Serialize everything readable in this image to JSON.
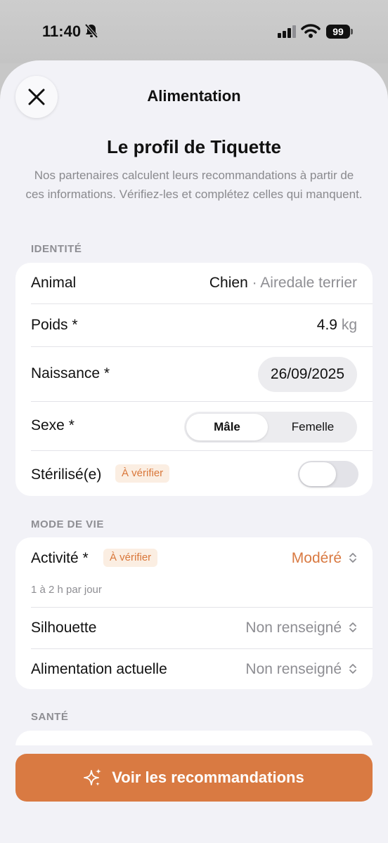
{
  "status_bar": {
    "time": "11:40",
    "battery": "99",
    "icons": [
      "bell-slash-icon",
      "signal-icon",
      "wifi-icon",
      "battery-icon"
    ]
  },
  "nav": {
    "title": "Alimentation",
    "close_icon": "close-icon"
  },
  "header": {
    "title": "Le profil de Tiquette",
    "subtitle": "Nos partenaires calculent leurs recommandations à partir de ces informations. Vérifiez-les et complétez celles qui manquent."
  },
  "identite": {
    "section_label": "IDENTITÉ",
    "animal": {
      "label": "Animal",
      "species": "Chien",
      "separator": " · ",
      "breed": "Airedale terrier"
    },
    "poids": {
      "label": "Poids *",
      "value": "4.9",
      "unit": "kg"
    },
    "naissance": {
      "label": "Naissance *",
      "value": "26/09/2025"
    },
    "sexe": {
      "label": "Sexe *",
      "options": [
        "Mâle",
        "Femelle"
      ],
      "selected": "Mâle"
    },
    "sterilise": {
      "label": "Stérilisé(e)",
      "badge": "À vérifier",
      "toggle_on": false
    }
  },
  "mode_de_vie": {
    "section_label": "MODE DE VIE",
    "activite": {
      "label": "Activité *",
      "badge": "À vérifier",
      "value": "Modéré",
      "helper": "1 à 2 h par jour"
    },
    "silhouette": {
      "label": "Silhouette",
      "value": "Non renseigné"
    },
    "alimentation_actuelle": {
      "label": "Alimentation actuelle",
      "value": "Non renseigné"
    }
  },
  "sante": {
    "section_label": "SANTÉ"
  },
  "cta": {
    "label": "Voir les recommandations",
    "icon": "sparkles-icon"
  },
  "colors": {
    "accent": "#d97a42",
    "badge_bg": "#fbeee2",
    "background": "#f2f2f7"
  }
}
